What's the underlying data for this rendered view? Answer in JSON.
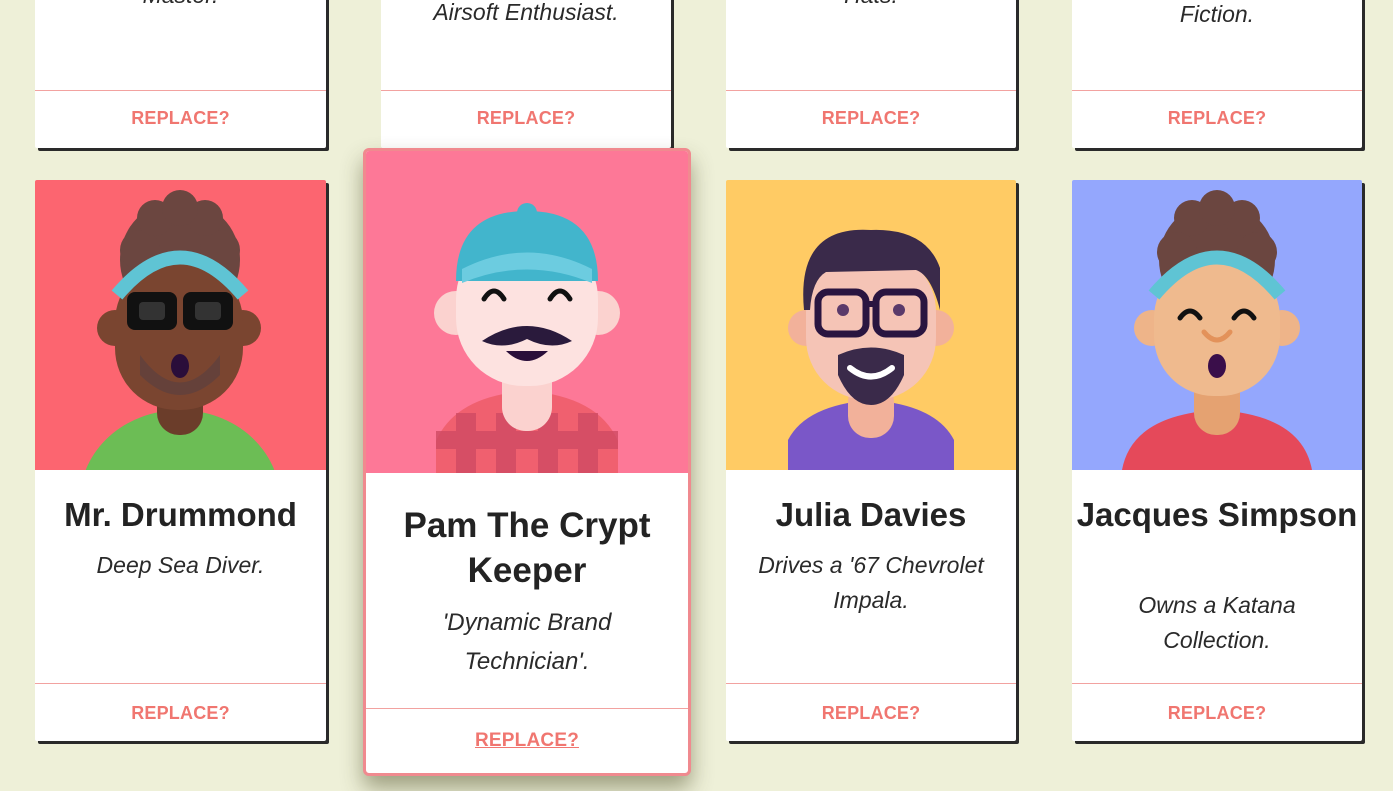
{
  "top_row": [
    {
      "description": "Master."
    },
    {
      "description": "Airsoft Enthusiast."
    },
    {
      "description": "Hats."
    },
    {
      "description": "Writes Avatar Fan Fiction."
    }
  ],
  "cards": [
    {
      "name": "Mr. Drummond",
      "role": "Deep Sea Diver.",
      "bg": "#fc6570",
      "avatar_icon": "avatar-man-glasses-headband"
    },
    {
      "name": "Pam The Crypt Keeper",
      "role": "'Dynamic Brand Technician'.",
      "bg": "#fd7897",
      "avatar_icon": "avatar-mustache-cap"
    },
    {
      "name": "Julia Davies",
      "role": "Drives a '67 Chevrolet Impala.",
      "bg": "#ffcb64",
      "avatar_icon": "avatar-glasses-goatee"
    },
    {
      "name": "Jacques Simpson",
      "role": "Owns a Katana Collection.",
      "bg": "#94a7fd",
      "avatar_icon": "avatar-headband-smile"
    }
  ],
  "replace_label": "REPLACE?",
  "colors": {
    "page_bg": "#eef0d8",
    "accent": "#f07670",
    "rule": "#f2a2a0"
  }
}
